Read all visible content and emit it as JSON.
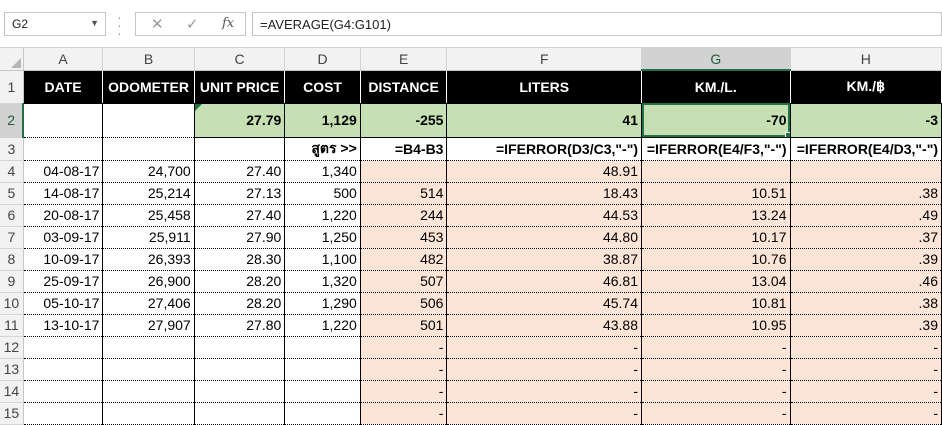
{
  "formula_bar": {
    "name_box": "G2",
    "cancel_icon": "✕",
    "enter_icon": "✓",
    "fx_icon": "fx",
    "formula": "=AVERAGE(G4:G101)"
  },
  "columns": [
    "A",
    "B",
    "C",
    "D",
    "E",
    "F",
    "G",
    "H"
  ],
  "row_numbers": [
    "1",
    "2",
    "3",
    "4",
    "5",
    "6",
    "7",
    "8",
    "9",
    "10",
    "11",
    "12",
    "13",
    "14",
    "15"
  ],
  "header_row": [
    "DATE",
    "ODOMETER",
    "UNIT PRICE",
    "COST",
    "DISTANCE",
    "LITERS",
    "KM./L.",
    "KM./฿"
  ],
  "summary_row": [
    "",
    "",
    "27.79",
    "1,129",
    "-255",
    "41",
    "-70",
    "-3"
  ],
  "formula_row": [
    "",
    "",
    "",
    "สูตร >>",
    "=B4-B3",
    "=IFERROR(D3/C3,\"-\")",
    "=IFERROR(E4/F3,\"-\")",
    "=IFERROR(E4/D3,\"-\")"
  ],
  "rows": [
    [
      "04-08-17",
      "24,700",
      "27.40",
      "1,340",
      "",
      "48.91",
      "",
      ""
    ],
    [
      "14-08-17",
      "25,214",
      "27.13",
      "500",
      "514",
      "18.43",
      "10.51",
      ".38"
    ],
    [
      "20-08-17",
      "25,458",
      "27.40",
      "1,220",
      "244",
      "44.53",
      "13.24",
      ".49"
    ],
    [
      "03-09-17",
      "25,911",
      "27.90",
      "1,250",
      "453",
      "44.80",
      "10.17",
      ".37"
    ],
    [
      "10-09-17",
      "26,393",
      "28.30",
      "1,100",
      "482",
      "38.87",
      "10.76",
      ".39"
    ],
    [
      "25-09-17",
      "26,900",
      "28.20",
      "1,320",
      "507",
      "46.81",
      "13.04",
      ".46"
    ],
    [
      "05-10-17",
      "27,406",
      "28.20",
      "1,290",
      "506",
      "45.74",
      "10.81",
      ".38"
    ],
    [
      "13-10-17",
      "27,907",
      "27.80",
      "1,220",
      "501",
      "43.88",
      "10.95",
      ".39"
    ],
    [
      "",
      "",
      "",
      "",
      "-",
      "-",
      "-",
      "-"
    ],
    [
      "",
      "",
      "",
      "",
      "-",
      "-",
      "-",
      "-"
    ],
    [
      "",
      "",
      "",
      "",
      "-",
      "-",
      "-",
      "-"
    ],
    [
      "",
      "",
      "",
      "",
      "-",
      "-",
      "-",
      "-"
    ]
  ],
  "colors": {
    "header_fill": "#000000",
    "summary_fill": "#c6e0b4",
    "calc_fill": "#fce4d6",
    "selection": "#217346"
  },
  "selected_cell": "G2"
}
